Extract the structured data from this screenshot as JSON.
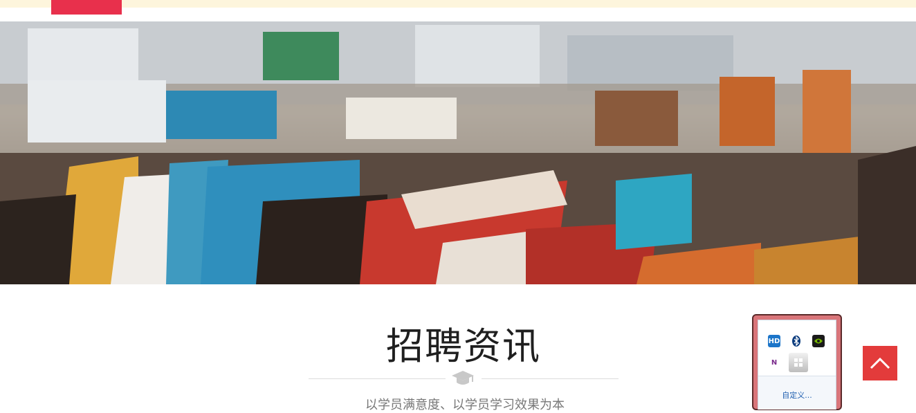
{
  "header": {
    "accent_color": "#e8304c",
    "bar_color": "#fdf5dc"
  },
  "hero": {
    "image_description_icon": "books-banner-image"
  },
  "section": {
    "title": "招聘资讯",
    "divider_icon": "graduation-cap-icon",
    "subtitle": "以学员满意度、以学员学习效果为本"
  },
  "tray_popup": {
    "icons": [
      "intel-graphics-icon",
      "bluetooth-icon",
      "nvidia-icon",
      "onenote-icon",
      "windows-update-icon"
    ],
    "icon_labels": {
      "intel": "HD",
      "onenote": "N"
    },
    "customize_label": "自定义..."
  },
  "back_to_top": {
    "icon": "chevron-up-icon",
    "color": "#e33b3b"
  }
}
